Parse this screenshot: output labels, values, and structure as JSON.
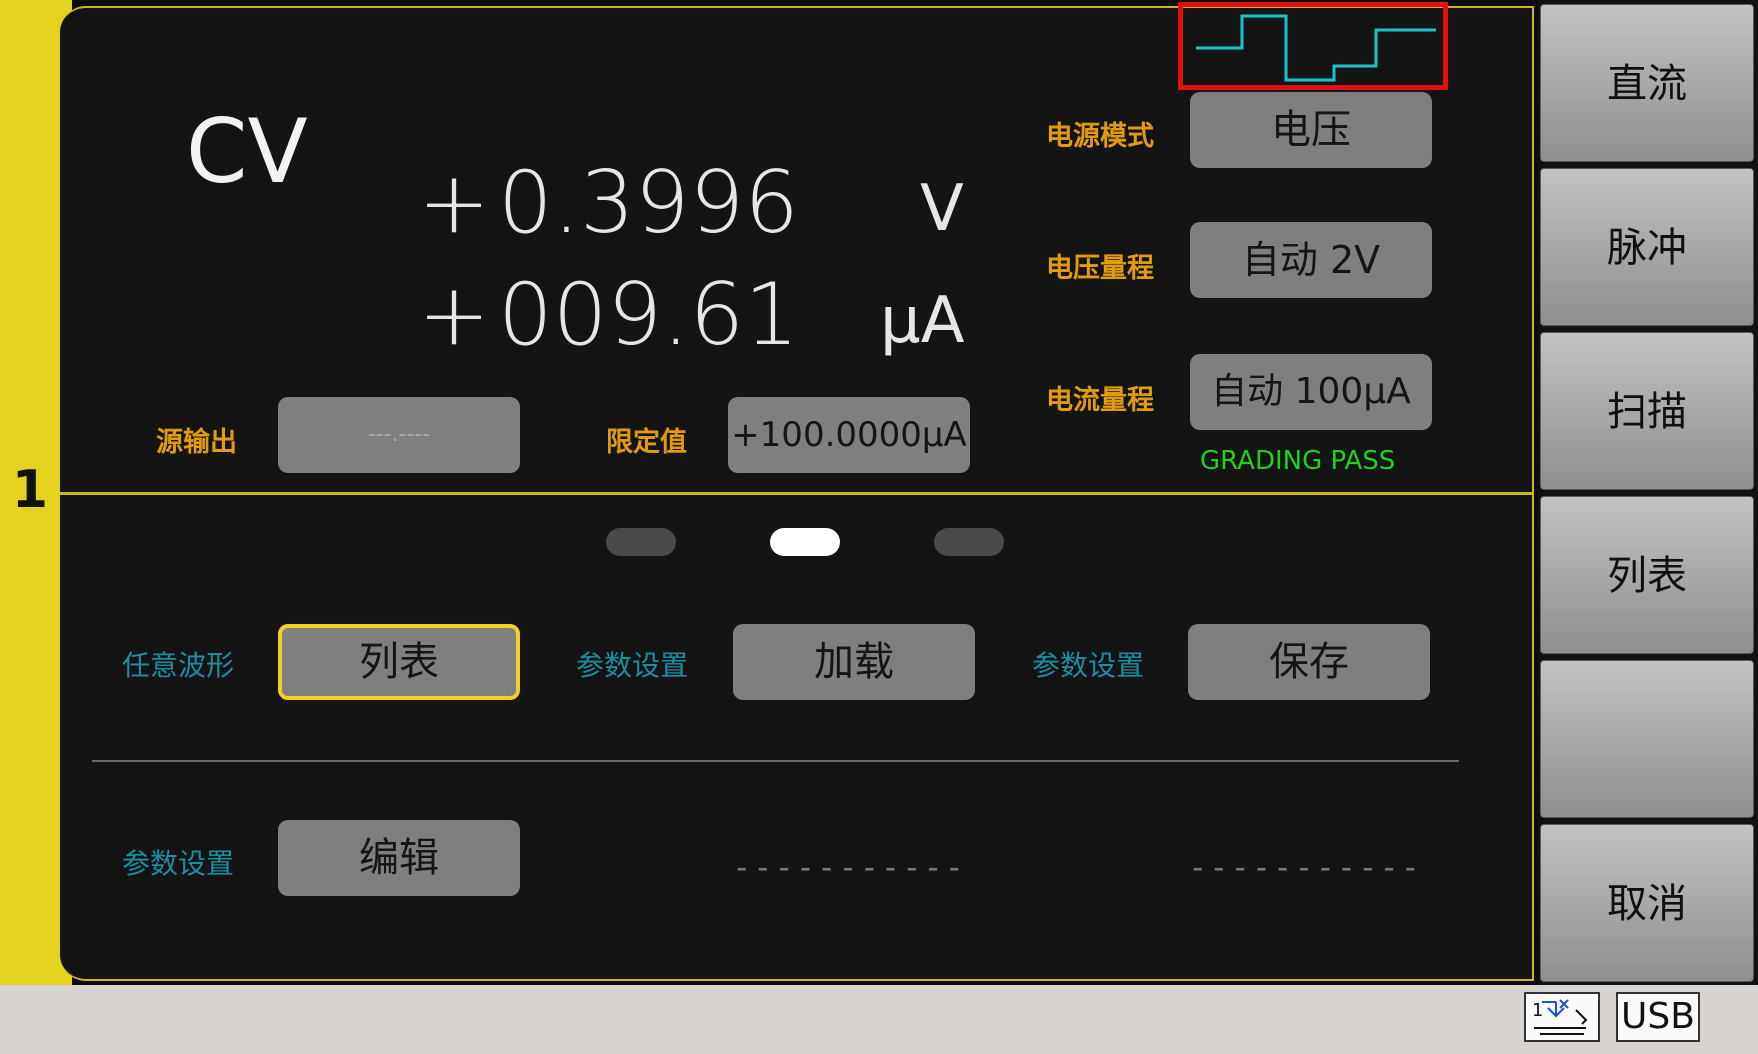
{
  "channel": {
    "number": "1"
  },
  "display": {
    "mode": "CV",
    "voltage": {
      "sign": "+",
      "value": "0.3996",
      "unit": "V"
    },
    "current": {
      "sign": "+",
      "value": "009.61",
      "unit": "µA"
    },
    "grading": "GRADING PASS",
    "waveform_icon": "pulse-waveform-icon"
  },
  "settings": {
    "source_output": {
      "label": "源输出",
      "value": "---.----"
    },
    "limit": {
      "label": "限定值",
      "value": "+100.0000µA"
    },
    "power_mode": {
      "label": "电源模式",
      "value": "电压"
    },
    "voltage_range": {
      "label": "电压量程",
      "value": "自动 2V"
    },
    "current_range": {
      "label": "电流量程",
      "value": "自动 100µA"
    }
  },
  "page_indicator": {
    "pages": 3,
    "active": 2
  },
  "params": {
    "arbitrary_wave": {
      "label": "任意波形",
      "value": "列表"
    },
    "load": {
      "label": "参数设置",
      "value": "加载"
    },
    "save": {
      "label": "参数设置",
      "value": "保存"
    },
    "edit": {
      "label": "参数设置",
      "value": "编辑"
    },
    "empty1": "-----------",
    "empty2": "-----------"
  },
  "softkeys": [
    "直流",
    "脉冲",
    "扫描",
    "列表",
    "",
    "取消"
  ],
  "status": {
    "usb": "USB",
    "trigger_icon": "trigger-icon"
  },
  "colors": {
    "accent_yellow": "#e4d21e",
    "orange_label": "#e29b10",
    "teal_label": "#1c8ea2",
    "pass_green": "#1ed21e",
    "wave_cyan": "#19c6c6",
    "highlight_red": "#e01010"
  }
}
